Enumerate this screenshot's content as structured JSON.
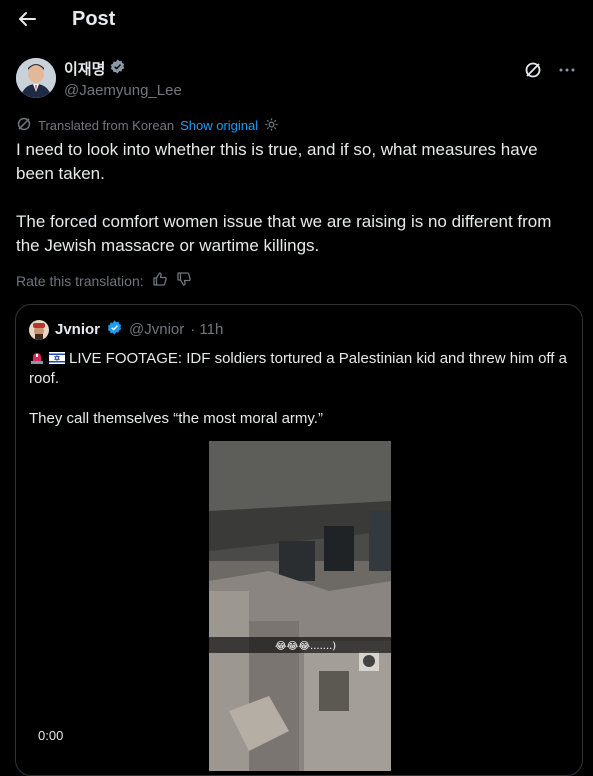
{
  "header": {
    "title": "Post"
  },
  "tweet": {
    "display_name": "이재명",
    "handle": "@Jaemyung_Lee",
    "translated_label": "Translated from Korean",
    "show_original": "Show original",
    "paragraphs": [
      "I need to look into whether this is true, and if so, what measures have been taken.",
      "The forced comfort women issue that we are raising is no different from the Jewish massacre or wartime killings."
    ],
    "rate_label": "Rate this translation:"
  },
  "quote": {
    "display_name": "Jvnior",
    "handle": "@Jvnior",
    "time": "· 11h",
    "line1": "LIVE FOOTAGE: IDF soldiers tortured a Palestinian kid and threw him off a roof.",
    "line2": "They call themselves “the most moral army.”",
    "video_caption": "😂😂😂.......)",
    "video_time": "0:00"
  },
  "colors": {
    "accent": "#1d9bf0",
    "muted": "#71767b",
    "text": "#e7e9ea",
    "border": "#2f3336",
    "background": "#000000"
  }
}
